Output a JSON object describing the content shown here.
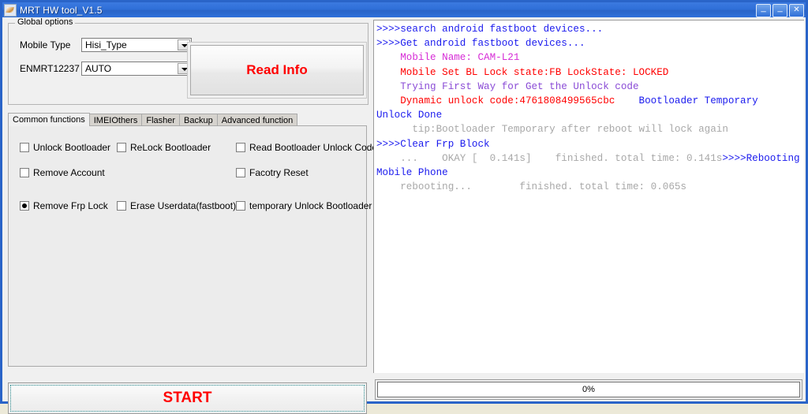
{
  "window": {
    "title": "MRT HW tool_V1.5",
    "icon": "app-icon",
    "minimize_label": "_",
    "maximize_label": "_",
    "close_label": "✕",
    "accent_color": "#2a64c8"
  },
  "global_options": {
    "legend": "Global options",
    "mobile_type": {
      "label": "Mobile Type",
      "value": "Hisi_Type"
    },
    "enmrt": {
      "label": "ENMRT12237",
      "value": "AUTO"
    },
    "read_info_label": "Read Info",
    "read_info_color": "#ff0000"
  },
  "tabs": [
    {
      "label": "Common functions",
      "active": true
    },
    {
      "label": "IMEIOthers",
      "active": false
    },
    {
      "label": "Flasher",
      "active": false
    },
    {
      "label": "Backup",
      "active": false
    },
    {
      "label": "Advanced function",
      "active": false
    }
  ],
  "options": [
    {
      "label": "Unlock Bootloader",
      "selected": false,
      "col": 0,
      "row": 0
    },
    {
      "label": "ReLock Bootloader",
      "selected": false,
      "col": 1,
      "row": 0
    },
    {
      "label": "Read Bootloader Unlock Code",
      "selected": false,
      "col": 2,
      "row": 0
    },
    {
      "label": "Remove Account",
      "selected": false,
      "col": 0,
      "row": 1
    },
    {
      "label": "Facotry Reset",
      "selected": false,
      "col": 2,
      "row": 1
    },
    {
      "label": "Remove Frp Lock",
      "selected": true,
      "col": 0,
      "row": 2
    },
    {
      "label": "Erase Userdata(fastboot)",
      "selected": false,
      "col": 1,
      "row": 2
    },
    {
      "label": "temporary Unlock Bootloader",
      "selected": false,
      "col": 2,
      "row": 2
    }
  ],
  "start": {
    "label": "START",
    "color": "#ff0000"
  },
  "log": {
    "segments": [
      {
        "text": ">>>>search android fastboot devices...\n",
        "color": "blue"
      },
      {
        "text": ">>>>Get android fastboot devices...\n",
        "color": "blue"
      },
      {
        "text": "    Mobile Name: CAM-L21\n",
        "color": "magenta"
      },
      {
        "text": "    Mobile Set BL Lock state:FB LockState: LOCKED\n",
        "color": "red"
      },
      {
        "text": "    Trying First Way for Get the Unlock code\n",
        "color": "purple"
      },
      {
        "text": "    Dynamic unlock code:4761808499565cbc    ",
        "color": "red"
      },
      {
        "text": "Bootloader Temporary  Unlock Done\n",
        "color": "blue"
      },
      {
        "text": "      tip:Bootloader Temporary after reboot will lock again\n",
        "color": "gray"
      },
      {
        "text": ">>>>Clear Frp Block\n",
        "color": "blue"
      },
      {
        "text": "    ...    OKAY [  0.141s]    finished. total time: 0.141s",
        "color": "gray"
      },
      {
        "text": ">>>>Rebooting Mobile Phone\n",
        "color": "blue"
      },
      {
        "text": "    rebooting...        finished. total time: 0.065s\n",
        "color": "gray"
      }
    ]
  },
  "progress": {
    "label": "0%",
    "value": 0
  }
}
